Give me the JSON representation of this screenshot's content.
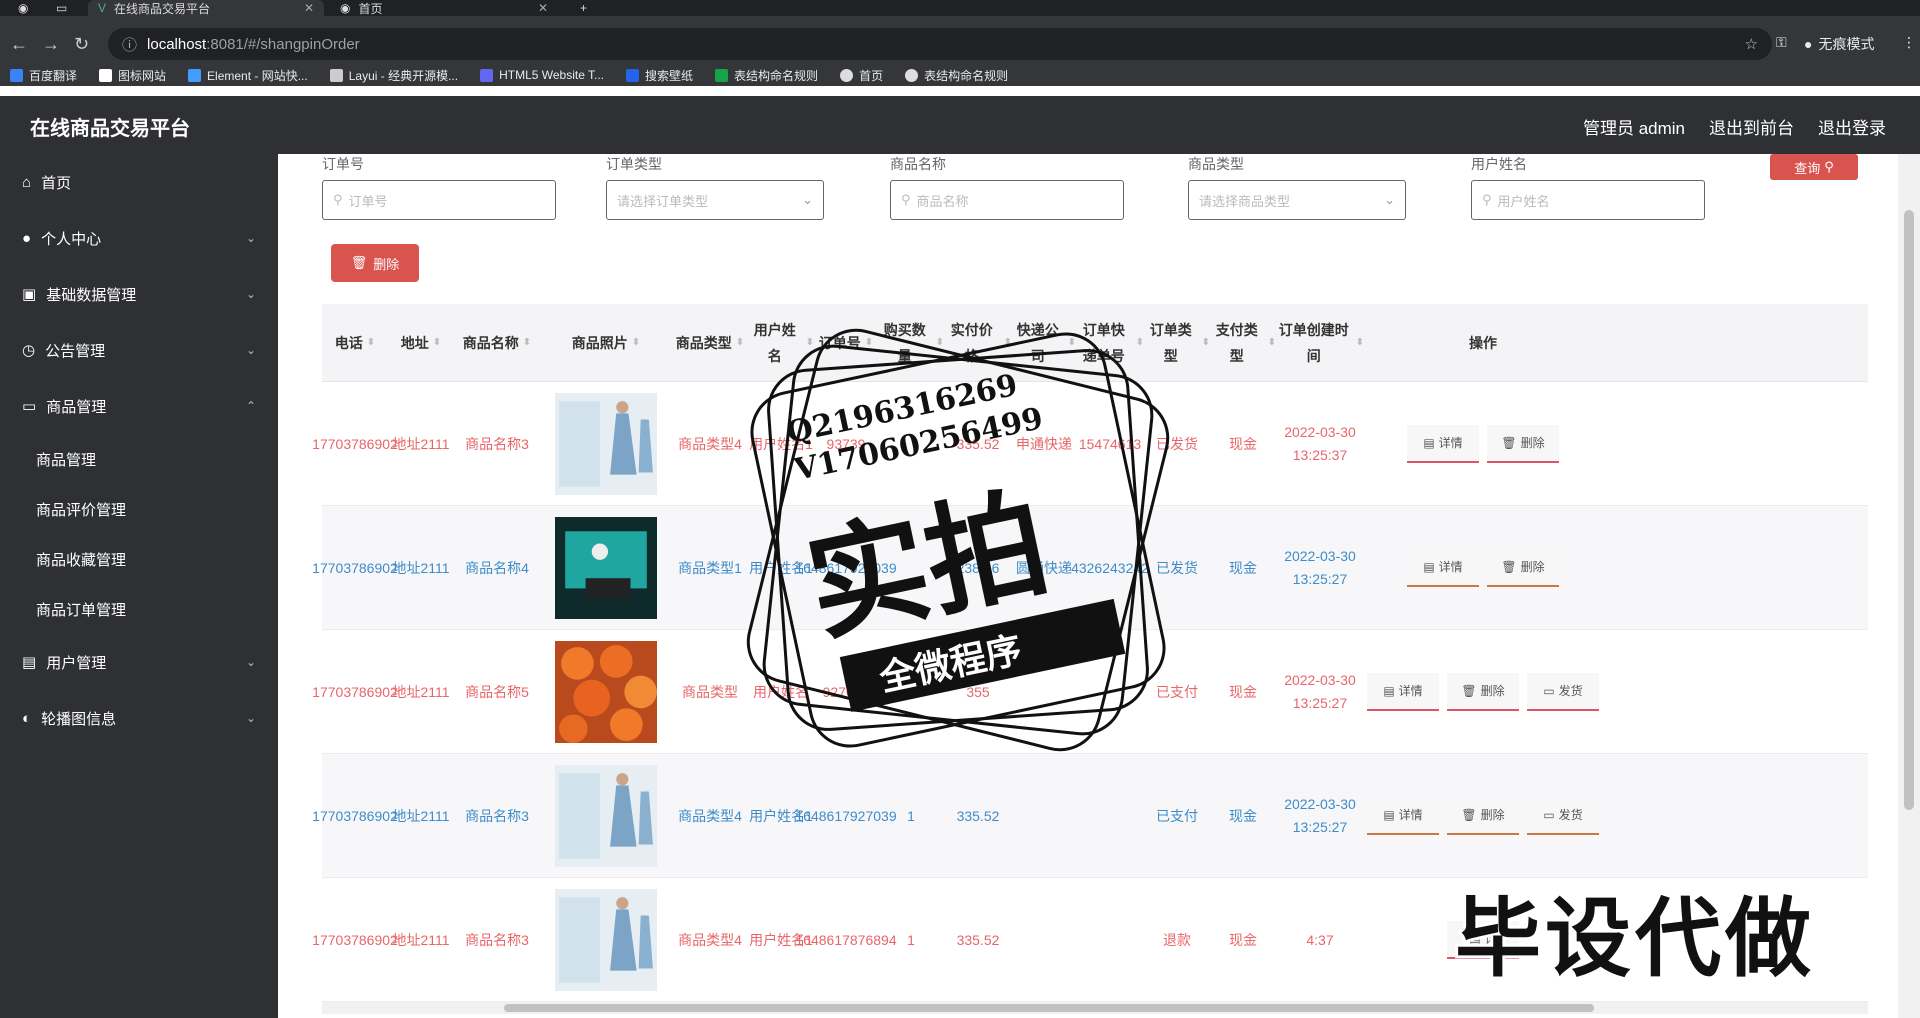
{
  "browser": {
    "tabs": [
      {
        "label": "",
        "active": false
      },
      {
        "label": "",
        "active": false
      },
      {
        "label": "在线商品交易平台",
        "active": true
      },
      {
        "label": "首页",
        "active": false
      }
    ],
    "url_host": "localhost",
    "url_path": ":8081/#/shangpinOrder",
    "incognito_label": "无痕模式",
    "bookmarks": [
      "百度翻译",
      "图标网站",
      "Element - 网站快...",
      "Layui - 经典开源模...",
      "HTML5 Website T...",
      "搜索壁纸",
      "表结构命名规则",
      "首页",
      "表结构命名规则"
    ]
  },
  "header": {
    "title": "在线商品交易平台",
    "links": [
      "管理员 admin",
      "退出到前台",
      "退出登录"
    ]
  },
  "sidebar": {
    "items": [
      {
        "label": "首页",
        "icon": "home-icon",
        "chev": ""
      },
      {
        "label": "个人中心",
        "icon": "user-icon",
        "chev": "⌄"
      },
      {
        "label": "基础数据管理",
        "icon": "data-icon",
        "chev": "⌄"
      },
      {
        "label": "公告管理",
        "icon": "clock-icon",
        "chev": "⌄"
      },
      {
        "label": "商品管理",
        "icon": "chat-icon",
        "chev": "⌃"
      }
    ],
    "subitems": [
      "商品管理",
      "商品评价管理",
      "商品收藏管理",
      "商品订单管理"
    ],
    "items2": [
      {
        "label": "用户管理",
        "icon": "users-icon",
        "chev": "⌄"
      },
      {
        "label": "轮播图信息",
        "icon": "image-icon",
        "chev": "⌄"
      }
    ]
  },
  "filters": [
    {
      "label": "订单号",
      "placeholder": "订单号",
      "type": "input"
    },
    {
      "label": "订单类型",
      "placeholder": "请选择订单类型",
      "type": "select"
    },
    {
      "label": "商品名称",
      "placeholder": "商品名称",
      "type": "input"
    },
    {
      "label": "商品类型",
      "placeholder": "请选择商品类型",
      "type": "select"
    },
    {
      "label": "用户姓名",
      "placeholder": "用户姓名",
      "type": "input"
    }
  ],
  "query_button": "查询",
  "delete_button": "删除",
  "columns": [
    "电话",
    "地址",
    "商品名称",
    "商品照片",
    "商品类型",
    "用户姓名",
    "订单号",
    "购买数量",
    "实付价格",
    "快递公司",
    "订单快递单号",
    "订单类型",
    "支付类型",
    "订单创建时间",
    "操作"
  ],
  "rows": [
    {
      "color": "red",
      "phone": "17703786902",
      "addr": "地址2111",
      "name": "商品名称3",
      "img": "dress",
      "type": "商品类型4",
      "user": "用户姓名1",
      "order": "93739",
      "qty": "",
      "price": "335.52",
      "courier": "申通快递",
      "track": "15474613",
      "otype": "已发货",
      "pay": "现金",
      "time": "2022-03-30 13:25:37",
      "actions": [
        "详情",
        "删除"
      ]
    },
    {
      "color": "blue",
      "phone": "17703786902",
      "addr": "地址2111",
      "name": "商品名称4",
      "img": "tech",
      "type": "商品类型1",
      "user": "用户姓名1",
      "order": "1648617927039",
      "qty": "",
      "price": "238.66",
      "courier": "圆通快递",
      "track": "4326243242",
      "otype": "已发货",
      "pay": "现金",
      "time": "2022-03-30 13:25:27",
      "actions": [
        "详情",
        "删除"
      ]
    },
    {
      "color": "red",
      "phone": "17703786902",
      "addr": "地址2111",
      "name": "商品名称5",
      "img": "flowers",
      "type": "商品类型",
      "user": "用户姓名",
      "order": "927039",
      "qty": "1",
      "price": "355",
      "courier": "",
      "track": "",
      "otype": "已支付",
      "pay": "现金",
      "time": "2022-03-30 13:25:27",
      "actions": [
        "详情",
        "删除",
        "发货"
      ]
    },
    {
      "color": "blue",
      "phone": "17703786902",
      "addr": "地址2111",
      "name": "商品名称3",
      "img": "dress",
      "type": "商品类型4",
      "user": "用户姓名1",
      "order": "1648617927039",
      "qty": "1",
      "price": "335.52",
      "courier": "",
      "track": "",
      "otype": "已支付",
      "pay": "现金",
      "time": "2022-03-30 13:25:27",
      "actions": [
        "详情",
        "删除",
        "发货"
      ]
    },
    {
      "color": "red",
      "phone": "17703786902",
      "addr": "地址2111",
      "name": "商品名称3",
      "img": "dress",
      "type": "商品类型4",
      "user": "用户姓名1",
      "order": "1648617876894",
      "qty": "1",
      "price": "335.52",
      "courier": "",
      "track": "",
      "otype": "退款",
      "pay": "现金",
      "time": "4:37",
      "actions": [
        "详"
      ]
    }
  ],
  "watermark": {
    "lines": [
      "Q2196316269",
      "V17060256499"
    ],
    "big": "实拍",
    "banner": "全微程序",
    "corner": "毕设代做"
  }
}
